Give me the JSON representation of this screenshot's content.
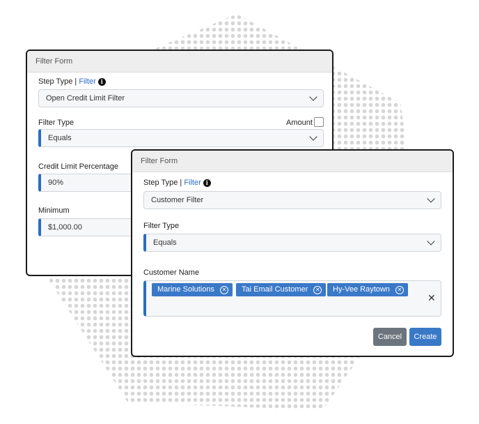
{
  "back_form": {
    "title": "Filter Form",
    "step_type_label": "Step Type |",
    "step_type_link": "Filter",
    "step_type_value": "Open Credit Limit Filter",
    "filter_type_label": "Filter Type",
    "amount_label": "Amount",
    "filter_type_value": "Equals",
    "credit_limit_label": "Credit Limit Percentage",
    "credit_limit_value": "90%",
    "minimum_label": "Minimum",
    "minimum_value": "$1,000.00"
  },
  "front_form": {
    "title": "Filter Form",
    "step_type_label": "Step Type |",
    "step_type_link": "Filter",
    "step_type_value": "Customer Filter",
    "filter_type_label": "Filter Type",
    "filter_type_value": "Equals",
    "customer_name_label": "Customer Name",
    "customers": [
      "Marine Solutions",
      "Tai Email Customer",
      "Hy-Vee Raytown"
    ],
    "clear_glyph": "✕",
    "tag_remove_glyph": "✕",
    "cancel_label": "Cancel",
    "create_label": "Create"
  },
  "colors": {
    "accent": "#2a6dc2",
    "tag": "#3a78c8",
    "cancel": "#6c757d",
    "create": "#3a78c8"
  },
  "icons": [
    "info-icon",
    "chevron-down-icon",
    "close-icon"
  ]
}
